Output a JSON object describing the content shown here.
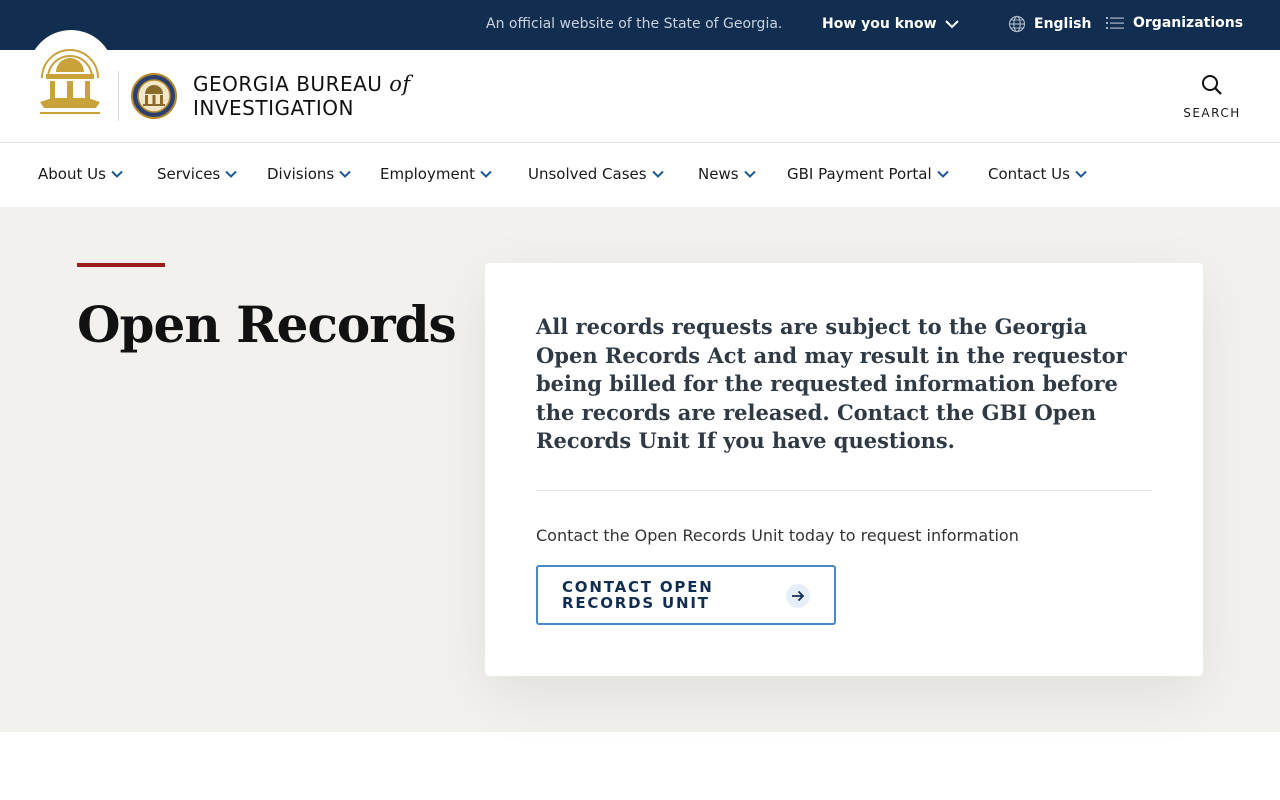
{
  "topbar": {
    "official_text": "An official website of the State of Georgia.",
    "how_you_know": "How you know",
    "language": "English",
    "organizations": "Organizations"
  },
  "header": {
    "brand_line1": "GEORGIA BUREAU",
    "brand_of": "of",
    "brand_line2": "INVESTIGATION",
    "search_label": "SEARCH"
  },
  "nav": {
    "items": [
      "About Us",
      "Services",
      "Divisions",
      "Employment",
      "Unsolved Cases",
      "News",
      "GBI Payment Portal",
      "Contact Us"
    ]
  },
  "hero": {
    "title": "Open Records",
    "lead": "All records requests are subject to the Georgia Open Records Act and may result in the requestor being billed for the requested information before the records are released. Contact the GBI Open Records Unit If you have questions.",
    "sub": "Contact the Open Records Unit today to request information",
    "button_label": "CONTACT OPEN RECORDS UNIT"
  },
  "colors": {
    "banner": "#112e51",
    "hero_bg": "#f2f1ed",
    "accent_red": "#9b1c1c",
    "button_border": "#4a88c7",
    "gold": "#c9a33a"
  },
  "icons": [
    "chevron-down-icon",
    "globe-icon",
    "list-icon",
    "search-icon",
    "arrow-right-icon"
  ]
}
